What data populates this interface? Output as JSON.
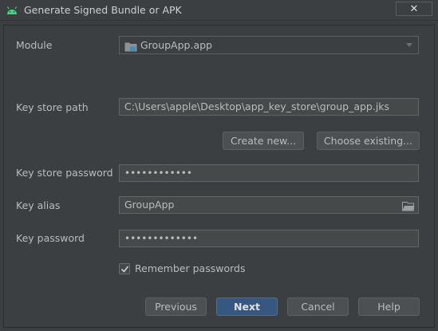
{
  "window": {
    "title": "Generate Signed Bundle or APK",
    "close_glyph": "✕"
  },
  "icons": {
    "app": "android-icon",
    "module": "module-folder-icon",
    "combo_arrow": "chevron-down-icon",
    "alias_browse": "folder-icon",
    "checkbox": "checkmark-icon"
  },
  "form": {
    "module_label": "Module",
    "module_value": "GroupApp.app",
    "key_store_path_label": "Key store path",
    "key_store_path_value": "C:\\Users\\apple\\Desktop\\app_key_store\\group_app.jks",
    "create_new_label": "Create new...",
    "choose_existing_label": "Choose existing...",
    "key_store_password_label": "Key store password",
    "key_store_password_mask": "••••••••••••",
    "key_alias_label": "Key alias",
    "key_alias_value": "GroupApp",
    "key_password_label": "Key password",
    "key_password_mask": "•••••••••••••",
    "remember_passwords_label": "Remember passwords",
    "remember_passwords_checked": true
  },
  "footer": {
    "previous_label": "Previous",
    "next_label": "Next",
    "cancel_label": "Cancel",
    "help_label": "Help"
  },
  "colors": {
    "background": "#3c3f41",
    "field_bg": "#45494a",
    "primary_button": "#365880",
    "android_green": "#3ddc84"
  }
}
